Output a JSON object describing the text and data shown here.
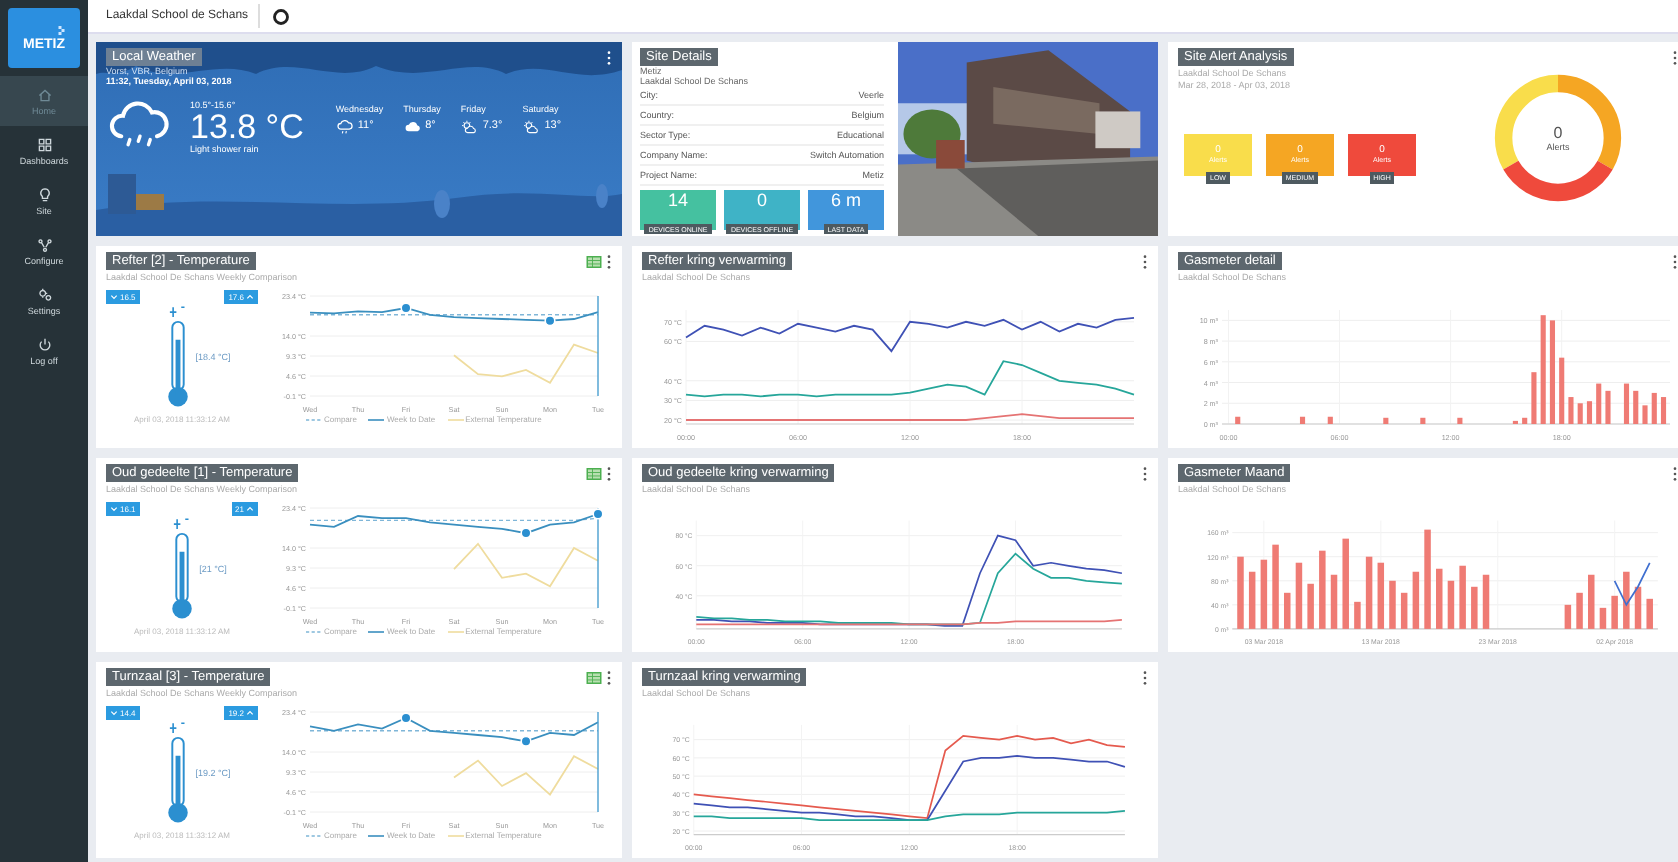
{
  "sidebar": {
    "logo": "METIZ",
    "items": [
      {
        "label": "Home",
        "selected": true
      },
      {
        "label": "Dashboards",
        "selected": false
      },
      {
        "label": "Site",
        "selected": false
      },
      {
        "label": "Configure",
        "selected": false
      },
      {
        "label": "Settings",
        "selected": false
      },
      {
        "label": "Log off",
        "selected": false
      }
    ]
  },
  "top_bar": {
    "site_tab": "Laakdal School de Schans"
  },
  "cards": [
    {
      "kind": "weather",
      "title": "Local Weather",
      "location": "Vorst, VBR, Belgium",
      "datetime": "11:32, Tuesday, April 03, 2018",
      "range": "10.5°-15.6°",
      "temperature": "13.8 °C",
      "condition": "Light shower rain",
      "forecast": [
        {
          "day": "Wednesday",
          "kind": "shower",
          "temp": "11°"
        },
        {
          "day": "Thursday",
          "kind": "cloudy",
          "temp": "8°"
        },
        {
          "day": "Friday",
          "kind": "partly_sunny",
          "temp": "7.3°"
        },
        {
          "day": "Saturday",
          "kind": "partly_sunny",
          "temp": "13°"
        }
      ]
    },
    {
      "kind": "site_details",
      "title": "Site Details",
      "company": "Metiz",
      "site": "Laakdal School De Schans",
      "fields": [
        {
          "label": "City:",
          "value": "Veerle"
        },
        {
          "label": "Country:",
          "value": "Belgium"
        },
        {
          "label": "Sector Type:",
          "value": "Educational"
        },
        {
          "label": "Company Name:",
          "value": "Switch Automation"
        },
        {
          "label": "Project Name:",
          "value": "Metiz"
        }
      ],
      "tiles": [
        {
          "value": "14",
          "label": "DEVICES ONLINE",
          "color": "#45c1a0"
        },
        {
          "value": "0",
          "label": "DEVICES OFFLINE",
          "color": "#3fb3c6"
        },
        {
          "value": "6 m",
          "label": "LAST DATA",
          "color": "#4196dc"
        }
      ],
      "photo": {
        "kind": "picture"
      }
    },
    {
      "kind": "alerts",
      "title": "Site Alert Analysis",
      "site": "Laakdal School De Schans",
      "period": "Mar 28, 2018 - Apr 03, 2018",
      "levels": [
        {
          "count": "0",
          "unit": "Alerts",
          "label": "LOW",
          "color": "#f9dd4b"
        },
        {
          "count": "0",
          "unit": "Alerts",
          "label": "MEDIUM",
          "color": "#f5a623"
        },
        {
          "count": "0",
          "unit": "Alerts",
          "label": "HIGH",
          "color": "#ef4a3c"
        }
      ],
      "total": "0",
      "total_label": "Alerts"
    },
    {
      "kind": "temperature",
      "title": "Refter [2] - Temperature",
      "subtitle": "Laakdal School De Schans Weekly Comparison",
      "low": "16.5",
      "high": "17.6",
      "reading": "[18.4 °C]",
      "timestamp": "April 03, 2018 11:33:12 AM",
      "chart_data": {
        "type": "line",
        "grid": true,
        "categories": [
          "Wed",
          null,
          "Thu",
          null,
          "Fri",
          null,
          "Sat",
          null,
          "Sun",
          null,
          "Mon",
          null,
          "Tue"
        ],
        "ylim": [
          -0.1,
          23.4
        ],
        "yticks": [
          {
            "value": -0.1,
            "label": "-0.1 °C"
          },
          {
            "value": 4.6,
            "label": "4.6 °C"
          },
          {
            "value": 9.3,
            "label": "9.3 °C"
          },
          {
            "value": 14,
            "label": "14.0 °C"
          },
          {
            "value": 23.4,
            "label": "23.4 °C"
          }
        ],
        "series": [
          {
            "name": "Compare",
            "color": "#7fb6d8",
            "line_style": "dashed",
            "values": [
              19,
              19,
              19,
              19,
              19,
              19,
              19,
              19,
              19,
              19,
              19,
              19,
              19
            ]
          },
          {
            "name": "Week to Date",
            "color": "#3a8fbf",
            "values": [
              19.5,
              19.3,
              19.8,
              19.6,
              20.6,
              19,
              18.4,
              18.2,
              18,
              17.8,
              17.6,
              18,
              19.6
            ]
          },
          {
            "name": "External Temperature",
            "color": "#efdc9e",
            "values": [
              null,
              null,
              null,
              null,
              null,
              null,
              9.5,
              5,
              4.5,
              6,
              3,
              12,
              10
            ]
          }
        ]
      }
    },
    {
      "kind": "chart",
      "title": "Refter kring verwarming",
      "subtitle": "Laakdal School De Schans",
      "chart_data": {
        "type": "line",
        "grid": true,
        "categories": [
          "00:00",
          null,
          null,
          null,
          null,
          null,
          "06:00",
          null,
          null,
          null,
          null,
          null,
          "12:00",
          null,
          null,
          null,
          null,
          null,
          "18:00",
          null,
          null,
          null,
          null,
          null,
          null
        ],
        "ylim": [
          18,
          76
        ],
        "yticks": [
          {
            "value": 20,
            "label": "20 °C"
          },
          {
            "value": 30,
            "label": "30 °C"
          },
          {
            "value": 40,
            "label": "40 °C"
          },
          {
            "value": 60,
            "label": "60 °C"
          },
          {
            "value": 70,
            "label": "70 °C"
          }
        ],
        "series": [
          {
            "color": "#3f51b5",
            "values": [
              62,
              68,
              66,
              63,
              67,
              64,
              69,
              67,
              65,
              68,
              66,
              55,
              70,
              69,
              67,
              70,
              68,
              71,
              66,
              70,
              65,
              69,
              67,
              71,
              72
            ]
          },
          {
            "color": "#26a69a",
            "values": [
              33,
              32,
              33,
              33,
              32,
              33,
              33,
              32,
              33,
              33,
              33,
              33,
              34,
              36,
              38,
              37,
              33,
              50,
              48,
              44,
              40,
              39,
              38,
              36,
              33
            ]
          },
          {
            "color": "#e57373",
            "values": [
              20,
              20,
              20,
              20,
              20,
              20,
              20,
              20,
              20,
              20,
              20,
              20,
              20,
              20,
              20,
              20,
              21,
              22,
              23,
              22,
              21,
              21,
              21,
              21,
              21
            ]
          }
        ]
      }
    },
    {
      "kind": "chart",
      "title": "Gasmeter detail",
      "subtitle": "Laakdal School De Schans",
      "chart_data": {
        "type": "bar",
        "grid": true,
        "categories": [
          "00:00",
          null,
          null,
          null,
          null,
          null,
          null,
          null,
          null,
          null,
          null,
          null,
          "06:00",
          null,
          null,
          null,
          null,
          null,
          null,
          null,
          null,
          null,
          null,
          null,
          "12:00",
          null,
          null,
          null,
          null,
          null,
          null,
          null,
          null,
          null,
          null,
          null,
          "18:00",
          null,
          null,
          null,
          null,
          null,
          null,
          null,
          null,
          null,
          null,
          null
        ],
        "ylim": [
          0,
          11
        ],
        "yticks": [
          {
            "value": 0,
            "label": "0 m³"
          },
          {
            "value": 2,
            "label": "2 m³"
          },
          {
            "value": 4,
            "label": "4 m³"
          },
          {
            "value": 6,
            "label": "6 m³"
          },
          {
            "value": 8,
            "label": "8 m³"
          },
          {
            "value": 10,
            "label": "10 m³"
          }
        ],
        "series": [
          {
            "color": "#ef7b74",
            "values": [
              0,
              0.7,
              0,
              0,
              0,
              0,
              0,
              0,
              0.7,
              0,
              0,
              0.7,
              0,
              0,
              0,
              0,
              0,
              0.6,
              0,
              0,
              0,
              0.6,
              0,
              0,
              0,
              0.6,
              0,
              0,
              0,
              0,
              0,
              0.3,
              0.6,
              5,
              10.5,
              10,
              6.4,
              2.6,
              2,
              2.2,
              3.9,
              3.2,
              0,
              3.9,
              3.2,
              1.8,
              3,
              2.6
            ]
          }
        ]
      }
    },
    {
      "kind": "temperature",
      "title": "Oud gedeelte [1] - Temperature",
      "subtitle": "Laakdal School De Schans Weekly Comparison",
      "low": "16.1",
      "high": "21",
      "reading": "[21 °C]",
      "timestamp": "April 03, 2018 11:33:12 AM",
      "chart_data": {
        "type": "line",
        "grid": true,
        "categories": [
          "Wed",
          null,
          "Thu",
          null,
          "Fri",
          null,
          "Sat",
          null,
          "Sun",
          null,
          "Mon",
          null,
          "Tue"
        ],
        "ylim": [
          -0.1,
          23.4
        ],
        "yticks": [
          {
            "value": -0.1,
            "label": "-0.1 °C"
          },
          {
            "value": 4.6,
            "label": "4.6 °C"
          },
          {
            "value": 9.3,
            "label": "9.3 °C"
          },
          {
            "value": 14,
            "label": "14.0 °C"
          },
          {
            "value": 23.4,
            "label": "23.4 °C"
          }
        ],
        "series": [
          {
            "name": "Compare",
            "color": "#7fb6d8",
            "line_style": "dashed",
            "values": [
              20.5,
              20.5,
              20.5,
              20.5,
              20.5,
              20.5,
              20.5,
              20.5,
              20.5,
              20.5,
              20.5,
              20.5,
              21
            ]
          },
          {
            "name": "Week to Date",
            "color": "#3a8fbf",
            "values": [
              19.5,
              19,
              21.5,
              21,
              21,
              20,
              19.5,
              19,
              18.5,
              17.5,
              19.5,
              20,
              22
            ]
          },
          {
            "name": "External Temperature",
            "color": "#efdc9e",
            "values": [
              null,
              null,
              null,
              null,
              null,
              null,
              9,
              15,
              7,
              8,
              5,
              14,
              11
            ]
          }
        ]
      }
    },
    {
      "kind": "chart",
      "title": "Oud gedeelte kring verwarming",
      "subtitle": "Laakdal School De Schans",
      "chart_data": {
        "type": "line",
        "grid": true,
        "categories": [
          "00:00",
          null,
          null,
          null,
          null,
          null,
          "06:00",
          null,
          null,
          null,
          null,
          null,
          "12:00",
          null,
          null,
          null,
          null,
          null,
          "18:00",
          null,
          null,
          null,
          null,
          null,
          null
        ],
        "ylim": [
          18,
          90
        ],
        "yticks": [
          {
            "value": 40,
            "label": "40 °C"
          },
          {
            "value": 60,
            "label": "60 °C"
          },
          {
            "value": 80,
            "label": "80 °C"
          }
        ],
        "series": [
          {
            "color": "#3f51b5",
            "values": [
              24,
              24,
              23,
              23,
              22,
              22,
              22,
              21,
              21,
              21,
              21,
              21,
              21,
              21,
              20,
              20,
              55,
              80,
              77,
              60,
              62,
              60,
              58,
              57,
              55
            ]
          },
          {
            "color": "#26a69a",
            "values": [
              26,
              25,
              25,
              24,
              24,
              23,
              23,
              23,
              22,
              22,
              22,
              22,
              21,
              21,
              21,
              21,
              22,
              55,
              68,
              58,
              52,
              52,
              50,
              49,
              48
            ]
          },
          {
            "color": "#e57373",
            "values": [
              21,
              21,
              21,
              21,
              21,
              21,
              21,
              21,
              21,
              21,
              21,
              21,
              21,
              21,
              21,
              21,
              22,
              22,
              23,
              23,
              23,
              23,
              23,
              23,
              24
            ]
          }
        ]
      }
    },
    {
      "kind": "chart",
      "title": "Gasmeter Maand",
      "subtitle": "Laakdal School De Schans",
      "chart_data": {
        "type": "bar",
        "grid": true,
        "categories": [
          null,
          null,
          "03 Mar 2018",
          null,
          null,
          null,
          null,
          null,
          null,
          null,
          null,
          null,
          "13 Mar 2018",
          null,
          null,
          null,
          null,
          null,
          null,
          null,
          null,
          null,
          "23 Mar 2018",
          null,
          null,
          null,
          null,
          null,
          null,
          null,
          null,
          null,
          "02 Apr 2018",
          null,
          null,
          null
        ],
        "ylim": [
          0,
          180
        ],
        "yticks": [
          {
            "value": 0,
            "label": "0 m³"
          },
          {
            "value": 40,
            "label": "40 m³"
          },
          {
            "value": 80,
            "label": "80 m³"
          },
          {
            "value": 120,
            "label": "120 m³"
          },
          {
            "value": 160,
            "label": "160 m³"
          }
        ],
        "series": [
          {
            "color": "#ef7b74",
            "values": [
              120,
              95,
              115,
              140,
              60,
              110,
              75,
              130,
              90,
              150,
              45,
              120,
              110,
              80,
              60,
              95,
              165,
              100,
              80,
              105,
              70,
              90,
              0,
              0,
              0,
              0,
              0,
              0,
              40,
              60,
              90,
              35,
              55,
              95,
              70,
              50
            ]
          },
          {
            "type": "line",
            "color": "#3f6fd0",
            "values": [
              null,
              null,
              null,
              null,
              null,
              null,
              null,
              null,
              null,
              null,
              null,
              null,
              null,
              null,
              null,
              null,
              null,
              null,
              null,
              null,
              null,
              null,
              null,
              null,
              null,
              null,
              null,
              null,
              null,
              null,
              null,
              null,
              80,
              40,
              70,
              110
            ]
          }
        ]
      }
    },
    {
      "kind": "temperature",
      "title": "Turnzaal [3] - Temperature",
      "subtitle": "Laakdal School De Schans Weekly Comparison",
      "low": "14.4",
      "high": "19.2",
      "reading": "[19.2 °C]",
      "timestamp": "April 03, 2018 11:33:12 AM",
      "chart_data": {
        "type": "line",
        "grid": true,
        "categories": [
          "Wed",
          null,
          "Thu",
          null,
          "Fri",
          null,
          "Sat",
          null,
          "Sun",
          null,
          "Mon",
          null,
          "Tue"
        ],
        "ylim": [
          -0.1,
          23.4
        ],
        "yticks": [
          {
            "value": -0.1,
            "label": "-0.1 °C"
          },
          {
            "value": 4.6,
            "label": "4.6 °C"
          },
          {
            "value": 9.3,
            "label": "9.3 °C"
          },
          {
            "value": 14,
            "label": "14.0 °C"
          },
          {
            "value": 23.4,
            "label": "23.4 °C"
          }
        ],
        "series": [
          {
            "name": "Compare",
            "color": "#7fb6d8",
            "line_style": "dashed",
            "values": [
              19,
              19,
              19,
              19,
              19,
              19,
              19,
              19,
              19,
              19,
              19,
              19,
              19
            ]
          },
          {
            "name": "Week to Date",
            "color": "#3a8fbf",
            "values": [
              20,
              19,
              20.5,
              19.5,
              22,
              19,
              18.5,
              18,
              17.5,
              16.5,
              18.5,
              18,
              21
            ]
          },
          {
            "name": "External Temperature",
            "color": "#efdc9e",
            "values": [
              null,
              null,
              null,
              null,
              null,
              null,
              8,
              12,
              6,
              9,
              4,
              13,
              10
            ]
          }
        ]
      }
    },
    {
      "kind": "chart",
      "title": "Turnzaal kring verwarming",
      "subtitle": "Laakdal School De Schans",
      "chart_data": {
        "type": "line",
        "grid": true,
        "categories": [
          "00:00",
          null,
          null,
          null,
          null,
          null,
          "06:00",
          null,
          null,
          null,
          null,
          null,
          "12:00",
          null,
          null,
          null,
          null,
          null,
          "18:00",
          null,
          null,
          null,
          null,
          null,
          null
        ],
        "ylim": [
          18,
          78
        ],
        "yticks": [
          {
            "value": 20,
            "label": "20 °C"
          },
          {
            "value": 30,
            "label": "30 °C"
          },
          {
            "value": 40,
            "label": "40 °C"
          },
          {
            "value": 50,
            "label": "50 °C"
          },
          {
            "value": 60,
            "label": "60 °C"
          },
          {
            "value": 70,
            "label": "70 °C"
          }
        ],
        "series": [
          {
            "color": "#e55a4e",
            "values": [
              40,
              39,
              38,
              37,
              36,
              35,
              34,
              33,
              32,
              31,
              30,
              29,
              28,
              27,
              64,
              72,
              71,
              70,
              72,
              70,
              71,
              68,
              70,
              67,
              66
            ]
          },
          {
            "color": "#3f51b5",
            "values": [
              35,
              34,
              33,
              33,
              32,
              31,
              30,
              30,
              29,
              28,
              28,
              27,
              26,
              26,
              42,
              58,
              60,
              60,
              61,
              60,
              60,
              59,
              58,
              58,
              55
            ]
          },
          {
            "color": "#26a69a",
            "values": [
              28,
              28,
              27,
              27,
              27,
              27,
              27,
              26,
              26,
              26,
              26,
              26,
              26,
              26,
              28,
              29,
              29,
              29,
              30,
              30,
              30,
              30,
              30,
              30,
              31
            ]
          }
        ]
      }
    }
  ]
}
